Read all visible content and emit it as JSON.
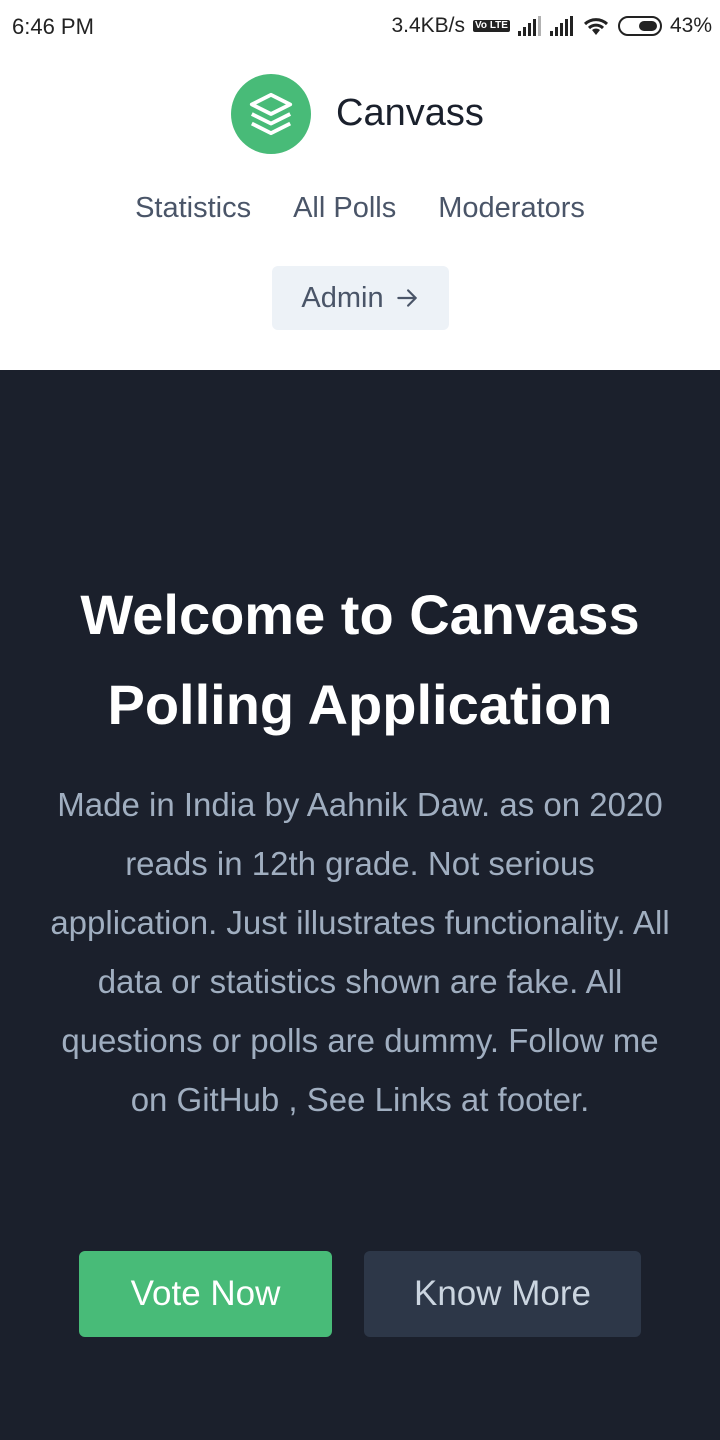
{
  "status": {
    "time": "6:46 PM",
    "speed": "3.4KB/s",
    "volte": "Vo LTE",
    "battery": "43%"
  },
  "header": {
    "brand": "Canvass",
    "logo_icon": "layers-icon",
    "nav": [
      "Statistics",
      "All Polls",
      "Moderators"
    ],
    "admin_label": "Admin",
    "admin_icon": "arrow-right-icon"
  },
  "hero": {
    "title": "Welcome to Canvass Polling Application",
    "description": "Made in India by Aahnik Daw. as on 2020 reads in 12th grade. Not serious application. Just illustrates functionality. All data or statistics shown are fake. All questions or polls are dummy. Follow me on GitHub , See Links at footer.",
    "vote_label": "Vote Now",
    "more_label": "Know More"
  },
  "colors": {
    "accent": "#48bb78",
    "hero_bg": "#1b202c",
    "secondary_btn": "#2d3748"
  }
}
